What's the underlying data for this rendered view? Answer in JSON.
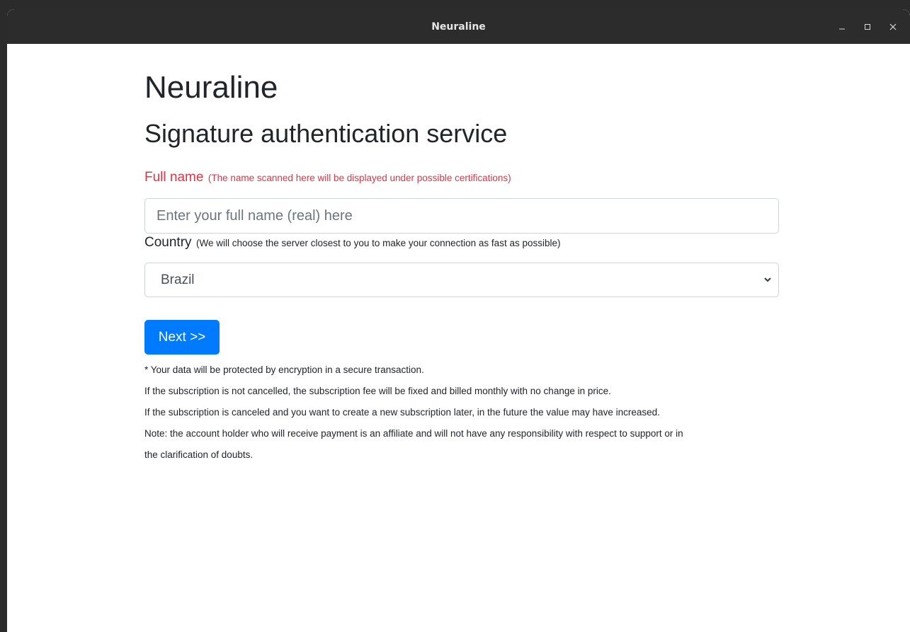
{
  "window": {
    "title": "Neuraline",
    "controls": {
      "minimize_icon": "minimize-icon",
      "maximize_icon": "maximize-icon",
      "close_icon": "close-icon"
    }
  },
  "page": {
    "heading": "Neuraline",
    "subheading": "Signature authentication service"
  },
  "form": {
    "full_name": {
      "label": "Full name",
      "note": "(The name scanned here will be displayed under possible certifications)",
      "value": "",
      "placeholder": "Enter your full name (real) here"
    },
    "country": {
      "label": "Country",
      "note": "(We will choose the server closest to you to make your connection as fast as possible)",
      "selected": "Brazil"
    },
    "next_label": "Next >>"
  },
  "notes": [
    "* Your data will be protected by encryption in a secure transaction.",
    "If the subscription is not cancelled, the subscription fee will be fixed and billed monthly with no change in price.",
    "If the subscription is canceled and you want to create a new subscription later, in the future the value may have increased.",
    "Note: the account holder who will receive payment is an affiliate and will not have any responsibility with respect to support or in",
    "the clarification of doubts."
  ],
  "colors": {
    "accent": "#007bff",
    "label_red": "#dc3545",
    "titlebar": "#2c2c2c"
  }
}
